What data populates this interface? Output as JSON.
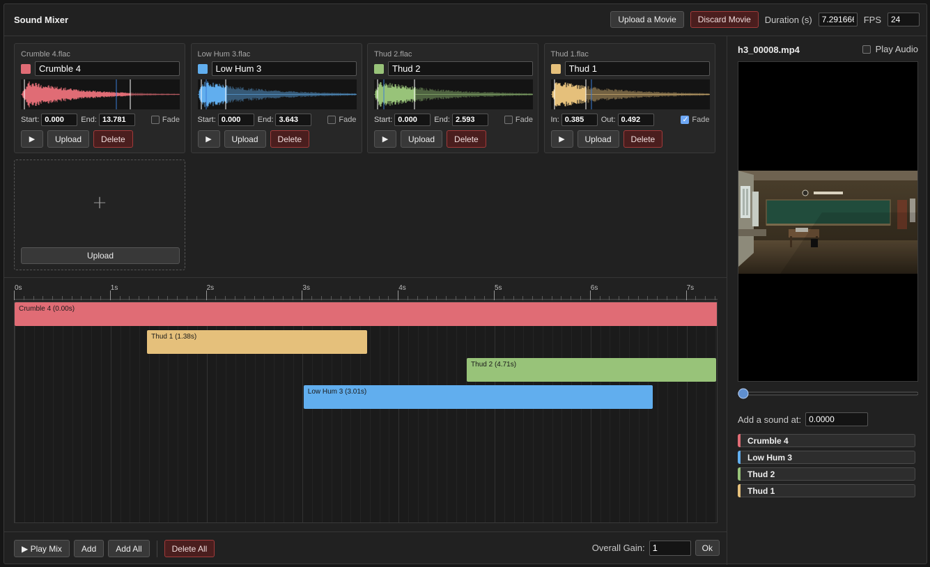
{
  "app": {
    "title": "Sound Mixer"
  },
  "header": {
    "upload_movie_label": "Upload a Movie",
    "discard_movie_label": "Discard Movie",
    "duration_label": "Duration (s)",
    "duration_value": "7.291666",
    "fps_label": "FPS",
    "fps_value": "24"
  },
  "sounds": [
    {
      "file": "Crumble 4.flac",
      "name": "Crumble 4",
      "color": "#e06c75",
      "start_label": "Start:",
      "start": "0.000",
      "end_label": "End:",
      "end": "13.781",
      "fade_label": "Fade",
      "fade": false
    },
    {
      "file": "Low Hum 3.flac",
      "name": "Low Hum 3",
      "color": "#61aeee",
      "start_label": "Start:",
      "start": "0.000",
      "end_label": "End:",
      "end": "3.643",
      "fade_label": "Fade",
      "fade": false
    },
    {
      "file": "Thud 2.flac",
      "name": "Thud 2",
      "color": "#98c379",
      "start_label": "Start:",
      "start": "0.000",
      "end_label": "End:",
      "end": "2.593",
      "fade_label": "Fade",
      "fade": false
    },
    {
      "file": "Thud 1.flac",
      "name": "Thud 1",
      "color": "#e5c07b",
      "start_label": "In:",
      "start": "0.385",
      "end_label": "Out:",
      "end": "0.492",
      "fade_label": "Fade",
      "fade": true
    }
  ],
  "card_buttons": {
    "play_icon": "play-icon",
    "upload_label": "Upload",
    "delete_label": "Delete"
  },
  "add_card": {
    "plus": "+",
    "upload_label": "Upload"
  },
  "timeline": {
    "ticks": [
      "0s",
      "1s",
      "2s",
      "3s",
      "4s",
      "5s",
      "6s",
      "7s"
    ],
    "clips": [
      {
        "label": "Crumble 4 (0.00s)",
        "start": 0.0,
        "end": 7.33,
        "row": 0,
        "color": "#e06c75"
      },
      {
        "label": "Thud 1 (1.38s)",
        "start": 1.38,
        "end": 3.67,
        "row": 1,
        "color": "#e5c07b"
      },
      {
        "label": "Thud 2 (4.71s)",
        "start": 4.71,
        "end": 7.31,
        "row": 2,
        "color": "#98c379"
      },
      {
        "label": "Low Hum 3 (3.01s)",
        "start": 3.01,
        "end": 6.65,
        "row": 3,
        "color": "#61aeee"
      }
    ]
  },
  "bottom": {
    "play_mix_label": "▶ Play Mix",
    "add_label": "Add",
    "add_all_label": "Add All",
    "delete_all_label": "Delete All",
    "gain_label": "Overall Gain:",
    "gain_value": "1",
    "ok_label": "Ok"
  },
  "side": {
    "movie_name": "h3_00008.mp4",
    "play_audio_label": "Play Audio",
    "play_audio": false,
    "scrub_position": 0,
    "add_at_label": "Add a sound at:",
    "add_at_value": "0.0000",
    "sound_list": [
      {
        "name": "Crumble 4",
        "color": "#e06c75"
      },
      {
        "name": "Low Hum 3",
        "color": "#61aeee"
      },
      {
        "name": "Thud 2",
        "color": "#98c379"
      },
      {
        "name": "Thud 1",
        "color": "#e5c07b"
      }
    ]
  }
}
